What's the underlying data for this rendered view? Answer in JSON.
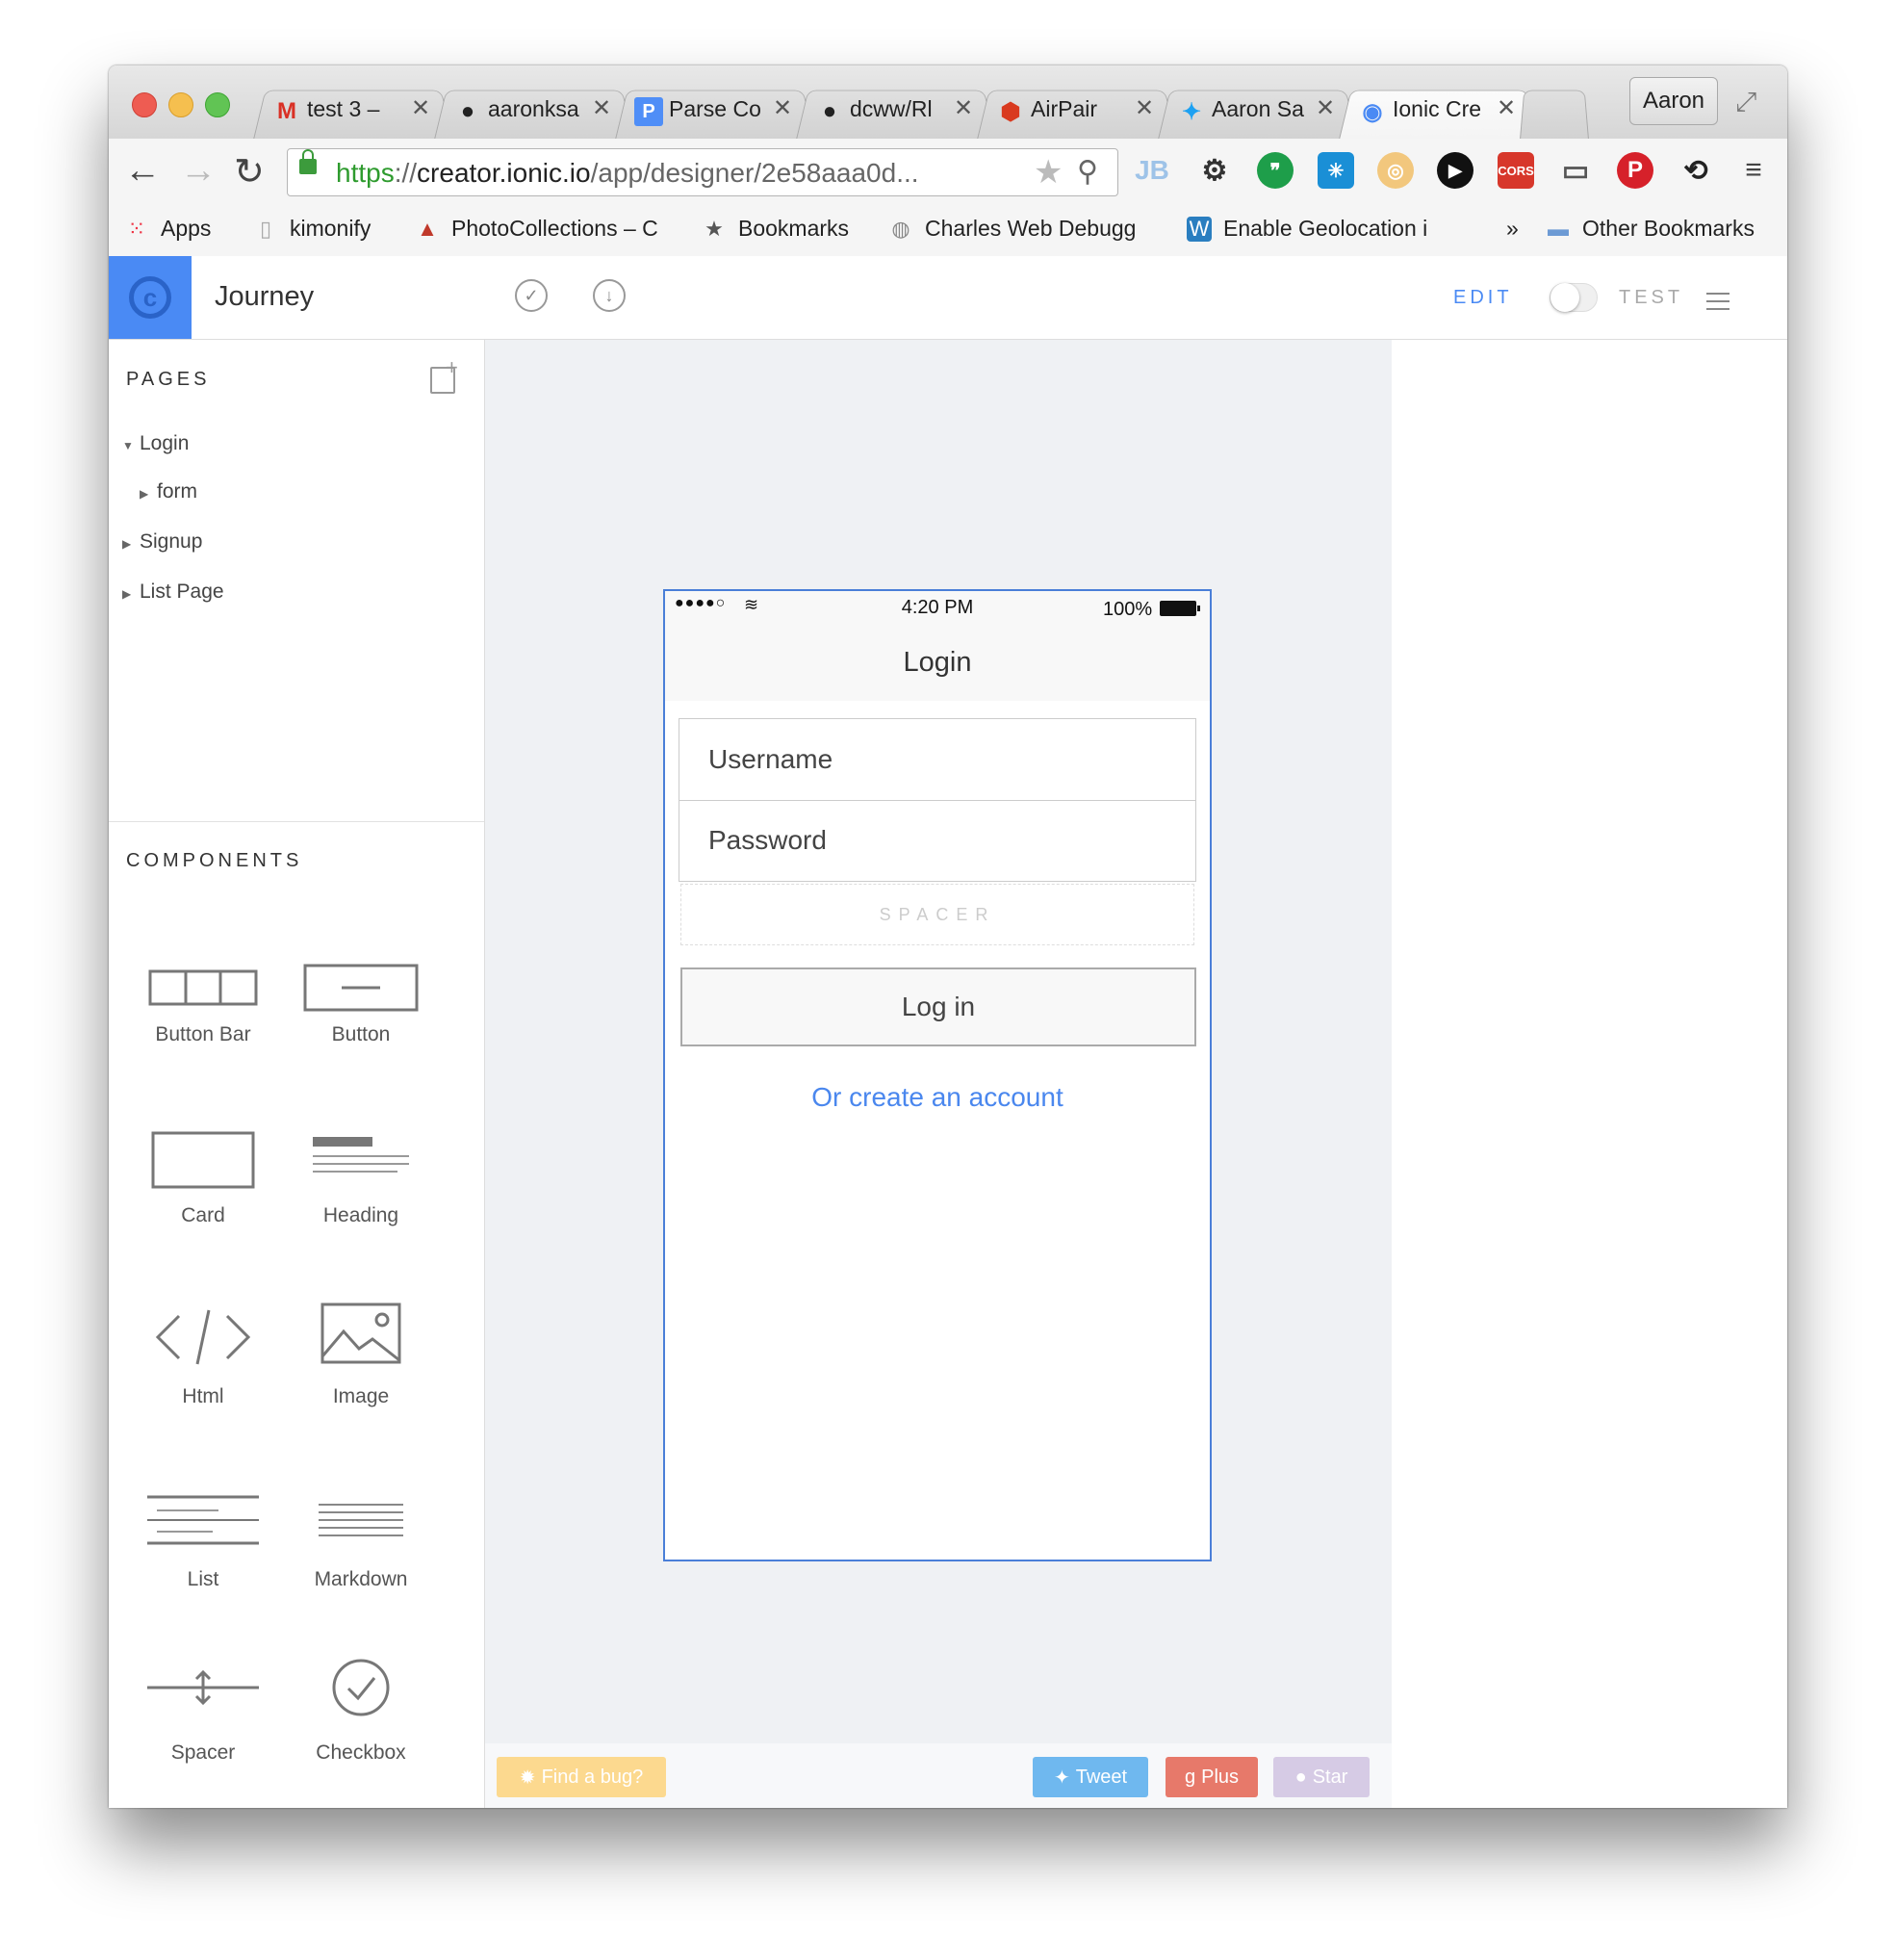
{
  "browser": {
    "tabs": [
      {
        "title": "test 3 –",
        "icon": "gmail-icon",
        "glyph": "M",
        "color": "#d93025"
      },
      {
        "title": "aaronksa",
        "icon": "github-icon",
        "glyph": "●",
        "color": "#222222"
      },
      {
        "title": "Parse Co",
        "icon": "parse-icon",
        "glyph": "P",
        "color": "#4f8ef7"
      },
      {
        "title": "dcww/Rl",
        "icon": "github-icon",
        "glyph": "●",
        "color": "#222222"
      },
      {
        "title": "AirPair",
        "icon": "airpair-icon",
        "glyph": "⬢",
        "color": "#d93a1f"
      },
      {
        "title": "Aaron Sa",
        "icon": "twitter-icon",
        "glyph": "✦",
        "color": "#1da1f2"
      },
      {
        "title": "Ionic Cre",
        "icon": "ionic-icon",
        "glyph": "◉",
        "color": "#4a8af4"
      }
    ],
    "profile": "Aaron",
    "url_scheme": "https",
    "url_sep": "://",
    "url_host": "creator.ionic.io",
    "url_path": "/app/designer/2e58aaa0d...",
    "bookmarks": [
      {
        "label": "Apps",
        "icon": "apps-grid-icon"
      },
      {
        "label": "kimonify",
        "icon": "page-icon"
      },
      {
        "label": "PhotoCollections – C",
        "icon": "photocollections-icon"
      },
      {
        "label": "Bookmarks",
        "icon": "star-icon"
      },
      {
        "label": "Charles Web Debugg",
        "icon": "charles-icon"
      },
      {
        "label": "Enable Geolocation i",
        "icon": "wordpress-icon"
      }
    ],
    "more_bookmarks": "»",
    "other_bookmarks": "Other Bookmarks"
  },
  "app": {
    "title": "Journey",
    "mode_edit": "EDIT",
    "mode_test": "TEST",
    "pages_title": "PAGES",
    "pages": [
      {
        "label": "Login",
        "expanded": true
      },
      {
        "label": "form",
        "expanded": false
      },
      {
        "label": "Signup",
        "expanded": false
      },
      {
        "label": "List Page",
        "expanded": false
      }
    ],
    "components_title": "COMPONENTS",
    "components": [
      {
        "label": "Button Bar"
      },
      {
        "label": "Button"
      },
      {
        "label": "Card"
      },
      {
        "label": "Heading"
      },
      {
        "label": "Html"
      },
      {
        "label": "Image"
      },
      {
        "label": "List"
      },
      {
        "label": "Markdown"
      },
      {
        "label": "Spacer"
      },
      {
        "label": "Checkbox"
      }
    ]
  },
  "phone": {
    "time": "4:20 PM",
    "battery": "100%",
    "signal": "●●●●○",
    "nav_title": "Login",
    "username_placeholder": "Username",
    "password_placeholder": "Password",
    "spacer_label": "SPACER",
    "login_button": "Log in",
    "create_link": "Or create an account"
  },
  "footer": {
    "find_bug": "Find a bug?",
    "tweet": "Tweet",
    "plus": "Plus",
    "star": "Star"
  },
  "colors": {
    "accent": "#4a8af4",
    "link": "#4a87ee",
    "find_bug": "#fcd98f",
    "tweet": "#6fb8ef",
    "plus": "#e7796a",
    "star": "#d6cbe5"
  }
}
